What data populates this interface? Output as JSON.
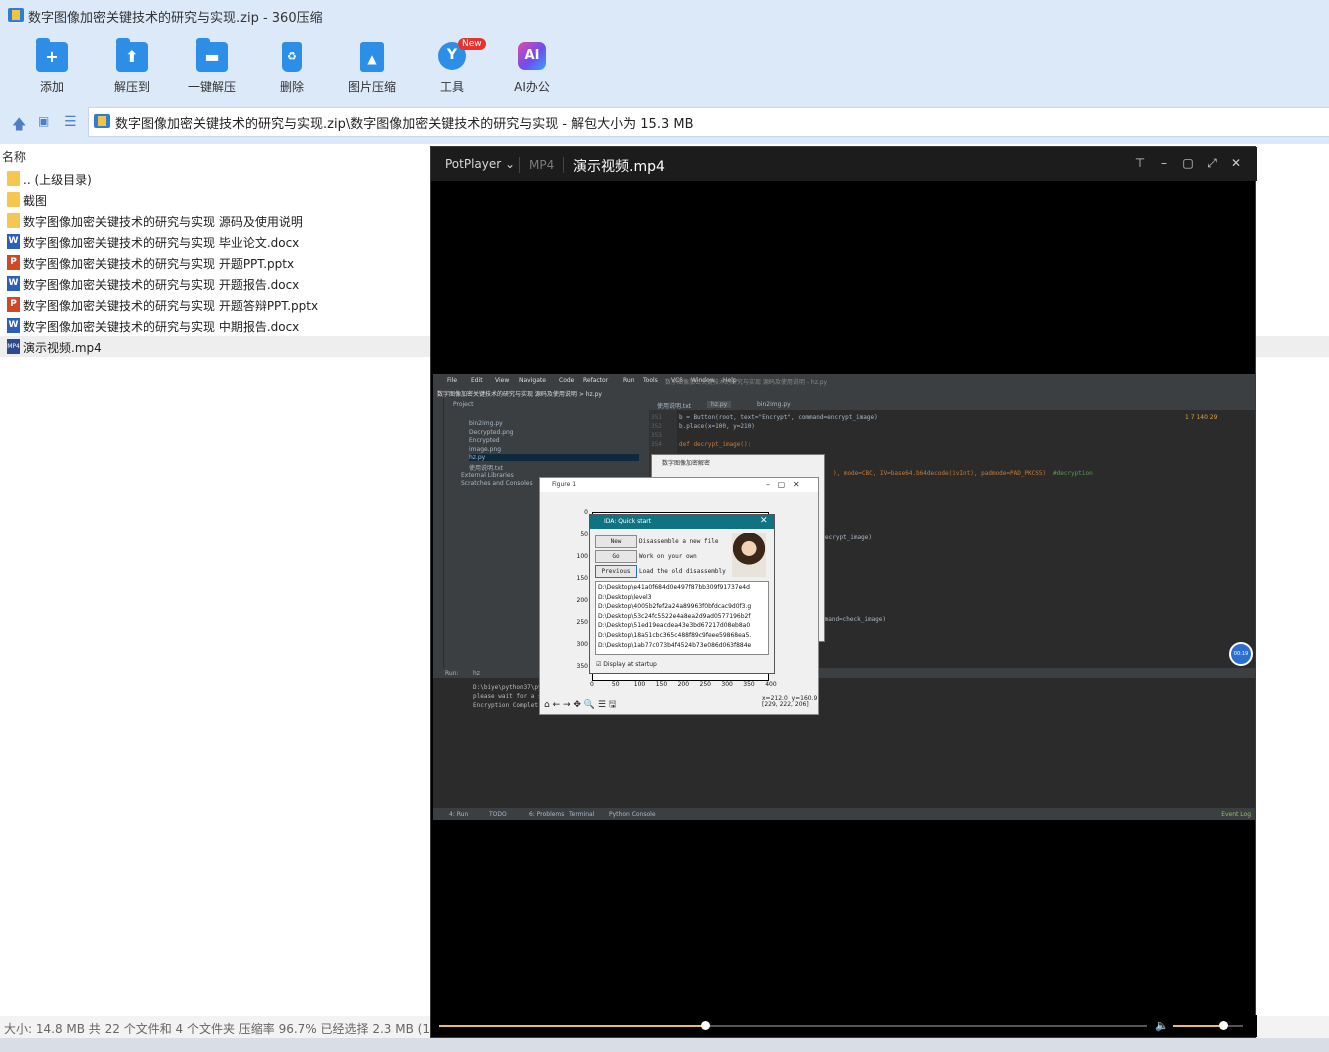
{
  "window": {
    "title": "数字图像加密关键技术的研究与实现.zip - 360压缩"
  },
  "toolbar": {
    "items": [
      {
        "label": "添加",
        "icon": "add-icon",
        "glyph": "+"
      },
      {
        "label": "解压到",
        "icon": "extract-to-icon",
        "glyph": "⬆"
      },
      {
        "label": "一键解压",
        "icon": "one-click-extract-icon",
        "glyph": "▬"
      },
      {
        "label": "删除",
        "icon": "delete-icon",
        "glyph": "♻"
      },
      {
        "label": "图片压缩",
        "icon": "image-compress-icon",
        "glyph": "▲"
      },
      {
        "label": "工具",
        "icon": "tools-icon",
        "glyph": "Y",
        "badge": "New"
      },
      {
        "label": "AI办公",
        "icon": "ai-office-icon",
        "glyph": "AI"
      }
    ]
  },
  "addressbar": {
    "path": "数字图像加密关键技术的研究与实现.zip\\数字图像加密关键技术的研究与实现 - 解包大小为 15.3 MB"
  },
  "filelist": {
    "header_name": "名称",
    "items": [
      {
        "name": ".. (上级目录)",
        "type": "folder"
      },
      {
        "name": "截图",
        "type": "folder"
      },
      {
        "name": "数字图像加密关键技术的研究与实现 源码及使用说明",
        "type": "folder"
      },
      {
        "name": "数字图像加密关键技术的研究与实现 毕业论文.docx",
        "type": "docx"
      },
      {
        "name": "数字图像加密关键技术的研究与实现 开题PPT.pptx",
        "type": "pptx"
      },
      {
        "name": "数字图像加密关键技术的研究与实现 开题报告.docx",
        "type": "docx"
      },
      {
        "name": "数字图像加密关键技术的研究与实现 开题答辩PPT.pptx",
        "type": "pptx"
      },
      {
        "name": "数字图像加密关键技术的研究与实现 中期报告.docx",
        "type": "docx"
      },
      {
        "name": "演示视频.mp4",
        "type": "mp4",
        "selected": true
      }
    ]
  },
  "status": {
    "text": "大小: 14.8 MB 共 22 个文件和 4 个文件夹 压缩率 96.7% 已经选择 2.3 MB (1 个"
  },
  "player": {
    "app": "PotPlayer",
    "format": "MP4",
    "filename": "演示视频.mp4",
    "progress": 0.376,
    "volume": 0.72,
    "time_badge": "00:19"
  },
  "video": {
    "ide_menu": [
      "File",
      "Edit",
      "View",
      "Navigate",
      "Code",
      "Refactor",
      "Run",
      "Tools",
      "VCS",
      "Window",
      "Help"
    ],
    "ide_window_title": "数字图像加密关键技术的研究与实现 源码及使用说明 - hz.py",
    "breadcrumb": "数字图像加密关键技术的研究与实现 源码及使用说明 > hz.py",
    "editor_tabs": [
      "使用说明.txt",
      "hz.py",
      "bin2img.py"
    ],
    "project_label": "Project",
    "project_tree": [
      "bin2img.py",
      "Decrypted.png",
      "Encrypted",
      "image.png",
      "hz.py",
      "使用说明.txt",
      "External Libraries",
      "Scratches and Consoles"
    ],
    "code_lines": [
      {
        "no": "351",
        "text": "b = Button(root, text=\"Encrypt\", command=encrypt_image)"
      },
      {
        "no": "352",
        "text": "b.place(x=100, y=210)"
      },
      {
        "no": "353",
        "text": ""
      },
      {
        "no": "354",
        "text": "def decrypt_image():"
      }
    ],
    "code_frag_1": "), mode=CBC, IV=base64.b64decode(ivInt), padmode=PAD_PKCS5)",
    "code_comment": "#decryption",
    "code_frag_2": "ecrypt_image)",
    "code_frag_3": "mmand=check_image)",
    "inspection": "1  7  140  29",
    "enc_window_title": "数字图像加密解密",
    "run_label": "Run:",
    "run_tab": "hz",
    "run_lines": [
      "D:\\biye\\python37\\py",
      "please wait for a s",
      "Encryption Complet"
    ],
    "bottom_tabs": [
      "4: Run",
      "TODO",
      "6: Problems",
      "Terminal",
      "Python Console"
    ],
    "event_log": "Event Log",
    "figure_title": "Figure 1",
    "figure_yticks": [
      "0",
      "50",
      "100",
      "150",
      "200",
      "250",
      "300",
      "350"
    ],
    "figure_xticks": [
      "0",
      "50",
      "100",
      "150",
      "200",
      "250",
      "300",
      "350",
      "400"
    ],
    "figure_coords": "x=212.0  y=160.9\n[229, 222, 206]",
    "ida_title": "IDA: Quick start",
    "ida_buttons": [
      {
        "label": "New",
        "desc": "Disassemble a new file"
      },
      {
        "label": "Go",
        "desc": "Work on your own"
      },
      {
        "label": "Previous",
        "desc": "Load the old disassembly"
      }
    ],
    "ida_recent": [
      "D:\\Desktop\\e41a0f684d0e497f87bb309f91737e4d",
      "D:\\Desktop\\level3",
      "D:\\Desktop\\4005b2fef2a24a89963f0bfdcac9d0f3.g",
      "D:\\Desktop\\53c24fc5522e4a8ea2d9ad0577196b2f",
      "D:\\Desktop\\51ed19eacdea43e3bd67217d08eb8a0",
      "D:\\Desktop\\18a51cbc365c488f89c9feee59868ea5.",
      "D:\\Desktop\\1ab77c073b4f4524b73e086d063f884e"
    ],
    "ida_checkbox": "Display at startup"
  }
}
